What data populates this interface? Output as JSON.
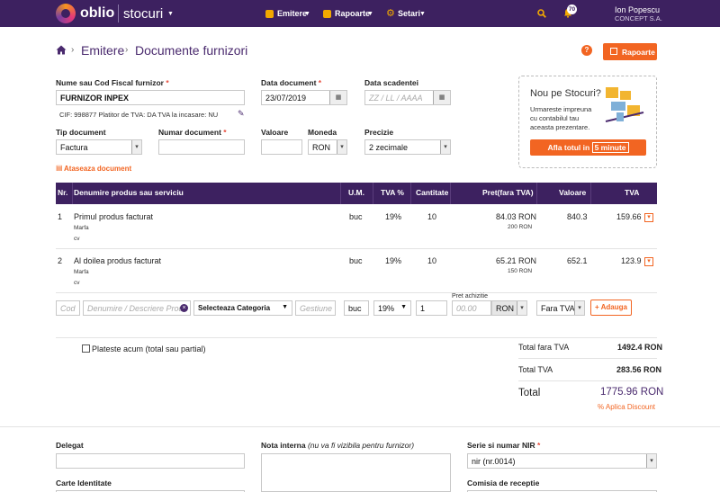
{
  "brand": {
    "name": "oblio",
    "product": "stocuri"
  },
  "nav": [
    {
      "label": "Emitere"
    },
    {
      "label": "Rapoarte"
    },
    {
      "label": "Setari"
    }
  ],
  "user": {
    "notifications": "70",
    "name": "Ion Popescu",
    "company": "CONCEPT S.A."
  },
  "breadcrumb": {
    "root": "Emitere",
    "current": "Documente furnizori"
  },
  "rapoarte_button": "Rapoarte",
  "colors": {
    "primary": "#3d2160",
    "accent": "#f26522"
  },
  "supplier": {
    "label": "Nume sau Cod Fiscal furnizor",
    "value": "FURNIZOR INPEX",
    "info": "CIF: 998877   Platitor de TVA: DA   TVA la incasare: NU"
  },
  "doc_date": {
    "label": "Data document",
    "value": "23/07/2019"
  },
  "due_date": {
    "label": "Data scadentei",
    "placeholder": "ZZ / LL / AAAA"
  },
  "promo": {
    "title": "Nou pe Stocuri?",
    "text1": "Urmareste impreuna",
    "text2": "cu contabilul tau",
    "text3": "aceasta prezentare.",
    "button": "Afla totul in",
    "button_highlight": "5 minute"
  },
  "doc_type": {
    "label": "Tip document",
    "value": "Factura"
  },
  "doc_number": {
    "label": "Numar document"
  },
  "value_field": {
    "label": "Valoare"
  },
  "currency": {
    "label": "Moneda",
    "value": "RON"
  },
  "precision": {
    "label": "Precizie",
    "value": "2 zecimale"
  },
  "attach": "Ataseaza document",
  "table": {
    "headers": [
      "Nr.",
      "Denumire produs sau serviciu",
      "U.M.",
      "TVA %",
      "Cantitate",
      "Pret(fara TVA)",
      "Valoare",
      "TVA"
    ],
    "rows": [
      {
        "nr": "1",
        "name": "Primul produs facturat",
        "cat": "Marfa",
        "mgmt": "cv",
        "um": "buc",
        "tva": "19%",
        "qty": "10",
        "price": "84.03 RON",
        "price_sub": "200 RON",
        "value": "840.3",
        "vat": "159.66"
      },
      {
        "nr": "2",
        "name": "Al doilea produs facturat",
        "cat": "Marfa",
        "mgmt": "cv",
        "um": "buc",
        "tva": "19%",
        "qty": "10",
        "price": "65.21 RON",
        "price_sub": "150 RON",
        "value": "652.1",
        "vat": "123.9"
      }
    ]
  },
  "add_row": {
    "code_ph": "Cod",
    "name_ph": "Denumire / Descriere Produ",
    "category": "Selecteaza Categoria",
    "mgmt_ph": "Gestiune",
    "um": "buc",
    "tva": "19%",
    "qty": "1",
    "purchase_label": "Pret achizitie",
    "price_ph": "00.00",
    "currency": "RON",
    "vat_mode": "Fara TVA",
    "add_button": "+ Adauga"
  },
  "pay_now": "Plateste acum (total sau partial)",
  "totals": {
    "net_label": "Total fara TVA",
    "net": "1492.4 RON",
    "vat_label": "Total TVA",
    "vat": "283.56 RON",
    "total_label": "Total",
    "total": "1775.96 RON",
    "discount": "% Aplica Discount"
  },
  "bottom": {
    "delegat": "Delegat",
    "note_label": "Nota interna",
    "note_hint": "(nu va fi vizibila pentru furnizor)",
    "nir_label": "Serie si numar NIR",
    "nir_value": "nir (nr.0014)",
    "id_card": "Carte Identitate",
    "commission": "Comisia de receptie"
  }
}
